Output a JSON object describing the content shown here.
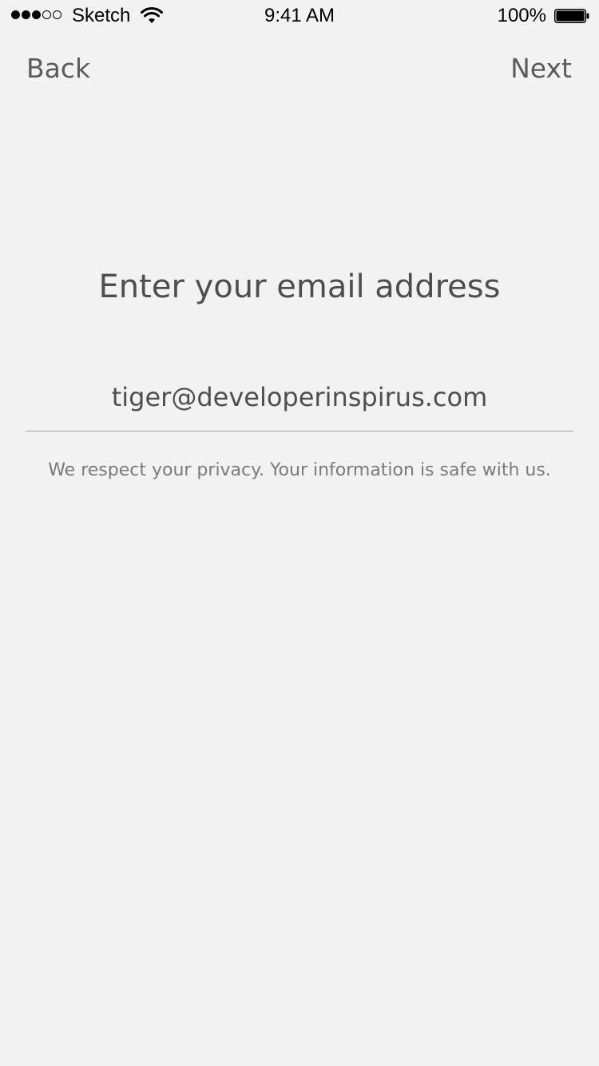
{
  "status_bar": {
    "carrier": "Sketch",
    "time": "9:41 AM",
    "battery_percent": "100%",
    "signal_strength": {
      "filled": 3,
      "total": 5
    },
    "battery_level": 1.0,
    "icons": [
      "signal-dots-icon",
      "wifi-icon",
      "battery-icon"
    ]
  },
  "nav": {
    "back_label": "Back",
    "next_label": "Next"
  },
  "form": {
    "title": "Enter your email address",
    "email_value": "tiger@developerinspirus.com",
    "privacy_note": "We respect your privacy. Your information is safe with us."
  },
  "colors": {
    "background": "#f2f2f2",
    "text": "#555555",
    "muted_text": "#7a7a7a",
    "divider": "#a8a8a8"
  }
}
